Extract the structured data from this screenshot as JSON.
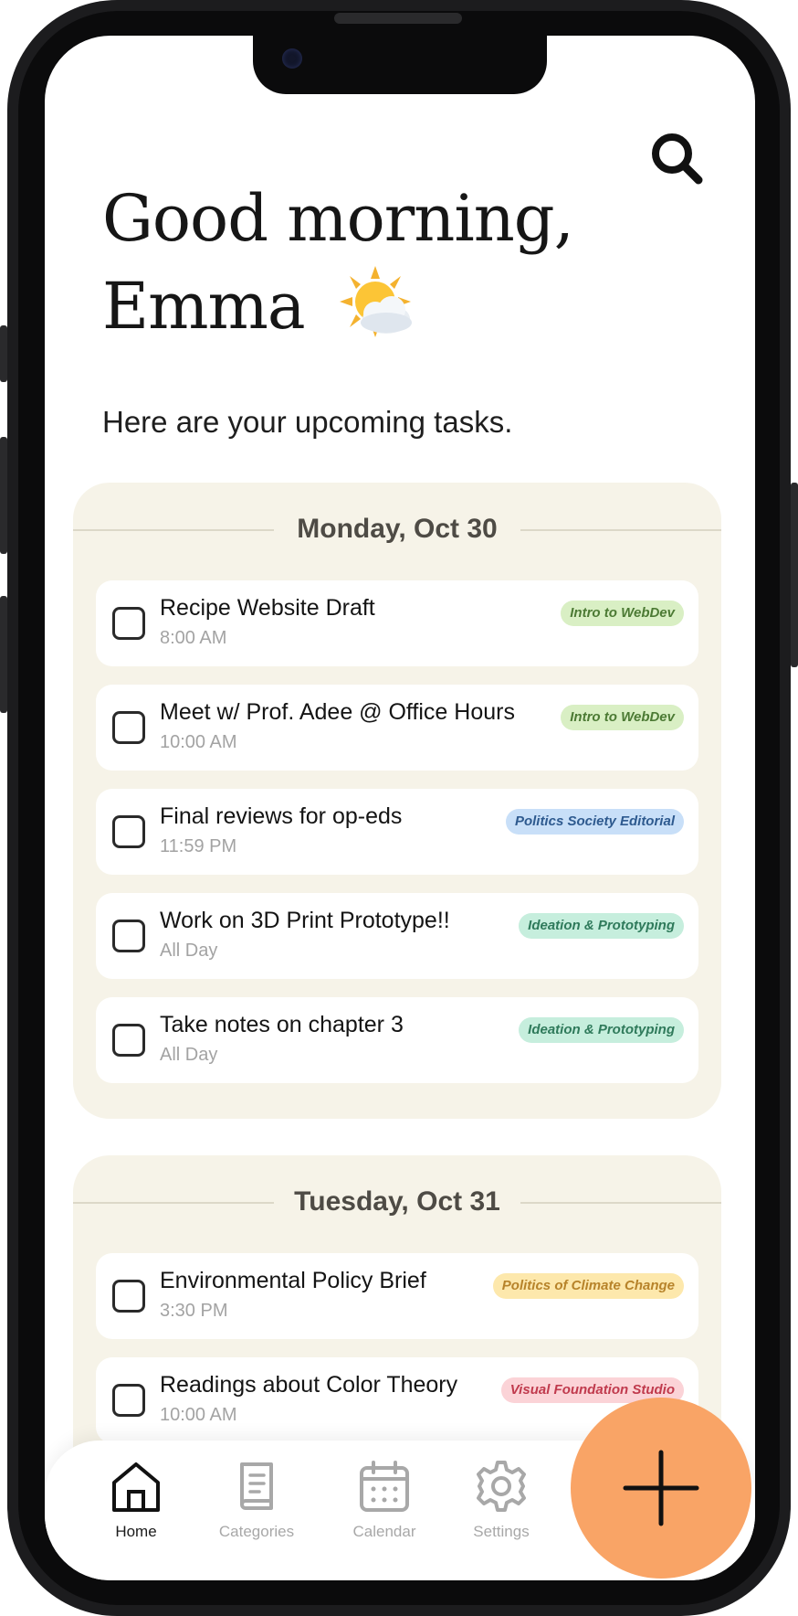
{
  "header": {
    "greeting_line1": "Good morning,",
    "greeting_line2": "Emma",
    "subtitle": "Here are your upcoming tasks."
  },
  "icons": {
    "search": "search-icon",
    "weather": "sun-behind-cloud-icon",
    "add": "plus-icon"
  },
  "colors": {
    "card_bg": "#f6f3e8",
    "fab": "#f9a466",
    "tag_green": "#d9efc4",
    "tag_blue": "#c8dff8",
    "tag_teal": "#c6eedd",
    "tag_yellow": "#fde8ac",
    "tag_pink": "#fbd3d7"
  },
  "days": [
    {
      "title": "Monday, Oct 30",
      "tasks": [
        {
          "name": "Recipe Website Draft",
          "time": "8:00 AM",
          "tag": "Intro to WebDev",
          "tag_color": "green"
        },
        {
          "name": "Meet w/ Prof. Adee @ Office Hours",
          "time": "10:00 AM",
          "tag": "Intro to WebDev",
          "tag_color": "green"
        },
        {
          "name": "Final reviews for op-eds",
          "time": "11:59 PM",
          "tag": "Politics Society Editorial",
          "tag_color": "blue"
        },
        {
          "name": "Work on 3D Print Prototype!!",
          "time": "All Day",
          "tag": "Ideation & Prototyping",
          "tag_color": "teal"
        },
        {
          "name": "Take notes on chapter 3",
          "time": "All Day",
          "tag": "Ideation & Prototyping",
          "tag_color": "teal"
        }
      ]
    },
    {
      "title": "Tuesday, Oct 31",
      "tasks": [
        {
          "name": "Environmental Policy Brief",
          "time": "3:30 PM",
          "tag": "Politics of Climate Change",
          "tag_color": "yellow"
        },
        {
          "name": "Readings about Color Theory",
          "time": "10:00 AM",
          "tag": "Visual Foundation Studio",
          "tag_color": "pink"
        }
      ]
    }
  ],
  "nav": {
    "items": [
      {
        "label": "Home",
        "icon": "home-icon",
        "active": true
      },
      {
        "label": "Categories",
        "icon": "book-icon"
      },
      {
        "label": "Calendar",
        "icon": "calendar-icon"
      },
      {
        "label": "Settings",
        "icon": "gear-icon"
      }
    ]
  }
}
